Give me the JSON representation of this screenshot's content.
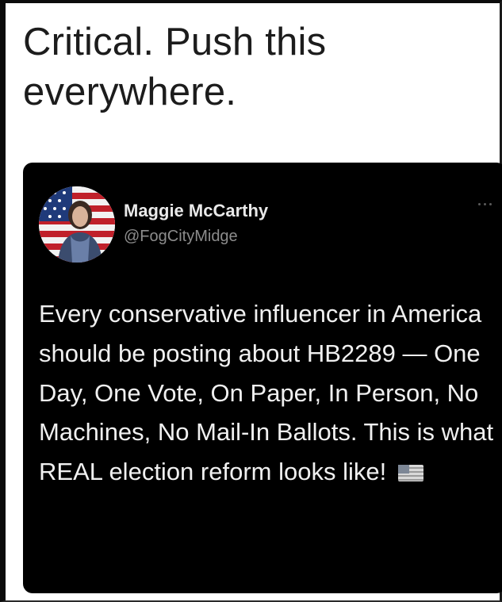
{
  "post": {
    "caption": "Critical. Push this everywhere."
  },
  "tweet": {
    "display_name": "Maggie McCarthy",
    "handle": "@FogCityMidge",
    "text": "Every conservative influencer in America should be posting about HB2289 — One Day, One Vote, On Paper, In Person, No Machines, No Mail-In Ballots. This is what REAL election reform looks like!",
    "emoji": "us-flag-icon",
    "menu_icon": "more-options-icon"
  },
  "colors": {
    "card_background": "#000000",
    "page_background": "#ffffff",
    "caption_text": "#1c1c1c",
    "tweet_text": "#f0f0f0",
    "handle_text": "#8c8c8c"
  }
}
